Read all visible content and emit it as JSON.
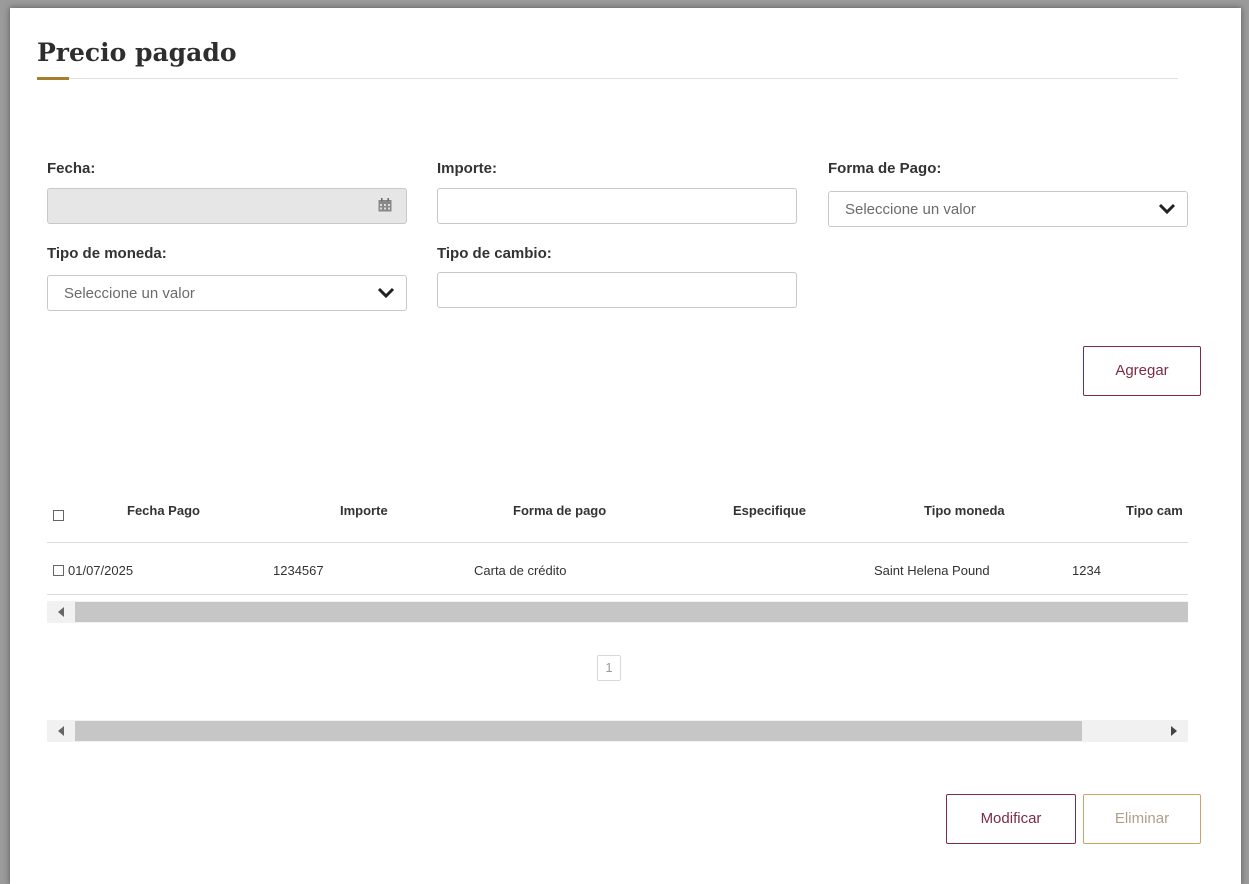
{
  "title": "Precio pagado",
  "form": {
    "fecha": {
      "label": "Fecha:",
      "value": ""
    },
    "importe": {
      "label": "Importe:",
      "value": ""
    },
    "forma_pago": {
      "label": "Forma de Pago:",
      "selected": "Seleccione un valor"
    },
    "tipo_moneda": {
      "label": "Tipo de moneda:",
      "selected": "Seleccione un valor"
    },
    "tipo_cambio": {
      "label": "Tipo de cambio:",
      "value": ""
    }
  },
  "buttons": {
    "agregar": "Agregar",
    "modificar": "Modificar",
    "eliminar": "Eliminar"
  },
  "table": {
    "columns": [
      "Fecha Pago",
      "Importe",
      "Forma de pago",
      "Especifique",
      "Tipo moneda",
      "Tipo cam"
    ],
    "rows": [
      {
        "fecha_pago": "01/07/2025",
        "importe": "1234567",
        "forma_pago": "Carta de crédito",
        "especifique": "",
        "tipo_moneda": "Saint Helena Pound",
        "tipo_cambio": "1234"
      }
    ]
  },
  "pagination": {
    "current_page": "1"
  },
  "colors": {
    "accent_gold": "#a57f2c",
    "primary_wine": "#7a2d43",
    "disabled_border": "#c9a568"
  },
  "icons": [
    "calendar-icon",
    "chevron-down-icon",
    "checkbox-icon",
    "scroll-left-arrow",
    "scroll-right-arrow"
  ]
}
